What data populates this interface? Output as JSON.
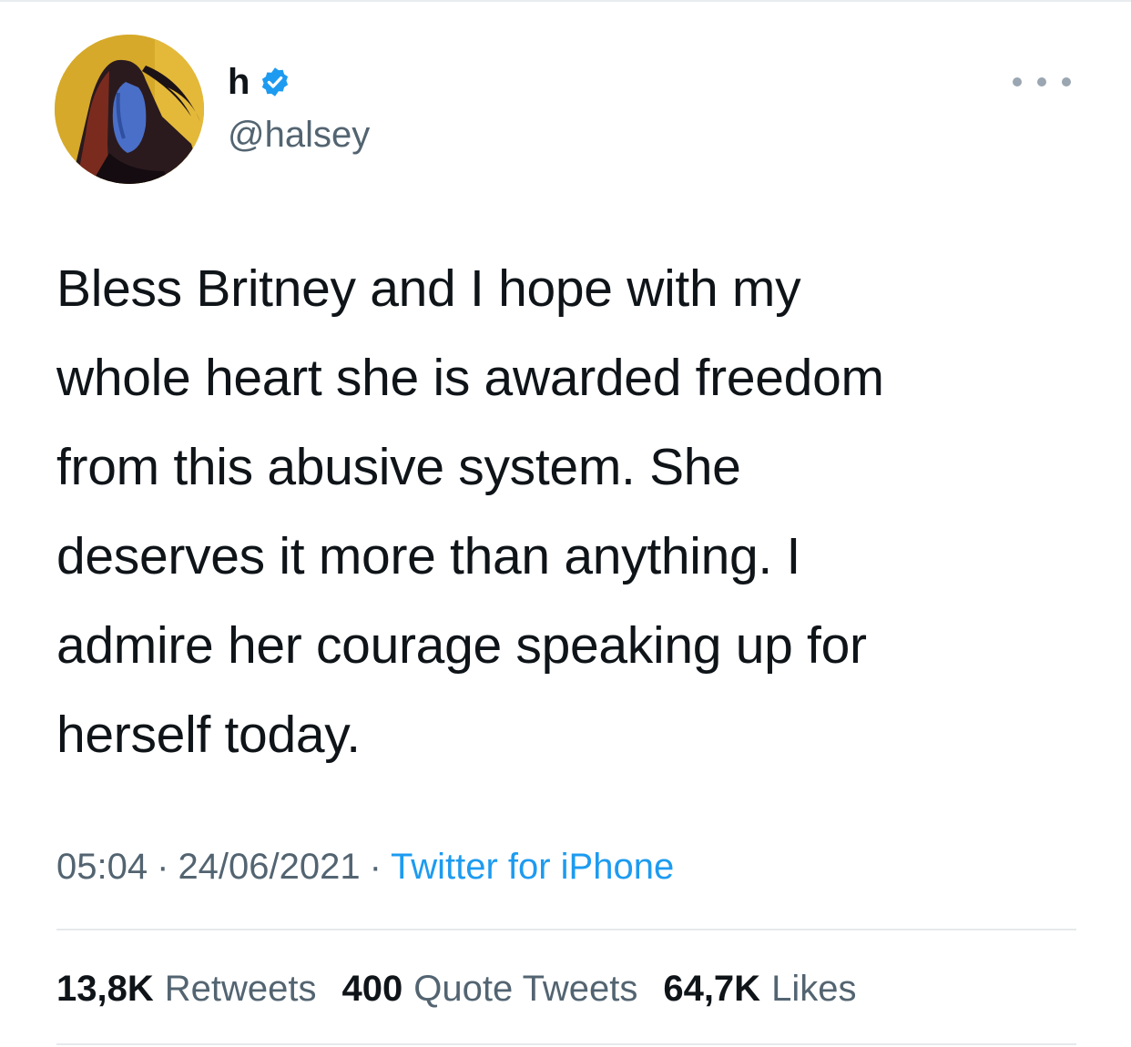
{
  "tweet": {
    "author": {
      "display_name": "h",
      "handle": "@halsey",
      "verified": true,
      "avatar_icon": "profile-photo"
    },
    "more_icon": "ellipsis-icon",
    "text_lines": [
      "Bless Britney and I hope with my",
      "whole heart she is awarded freedom",
      "from this abusive system. She",
      "deserves it more than anything. I",
      "admire her courage speaking up for",
      "herself today."
    ],
    "meta": {
      "time": "05:04",
      "separator": "·",
      "date": "24/06/2021",
      "source": "Twitter for iPhone"
    },
    "stats": {
      "retweets": {
        "count": "13,8K",
        "label": "Retweets"
      },
      "quote_tweets": {
        "count": "400",
        "label": "Quote Tweets"
      },
      "likes": {
        "count": "64,7K",
        "label": "Likes"
      }
    },
    "colors": {
      "accent": "#1d9bf0",
      "secondary_text": "#536471",
      "primary_text": "#0f1419"
    }
  }
}
